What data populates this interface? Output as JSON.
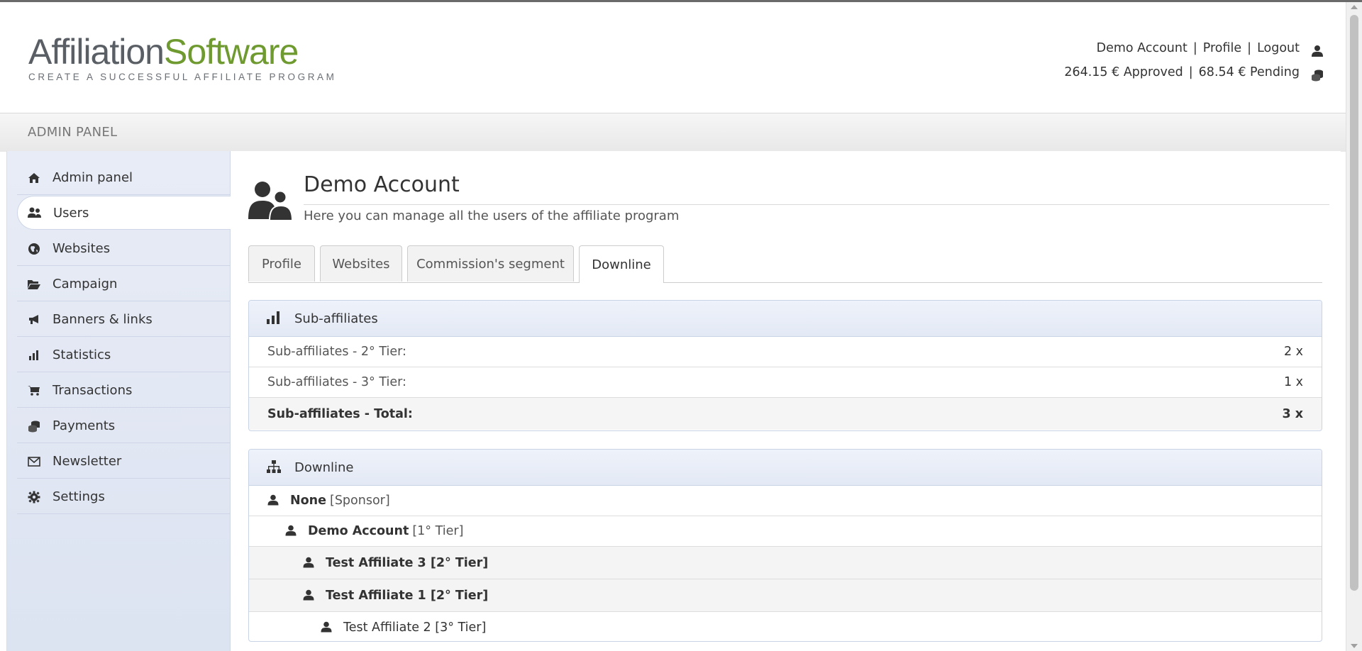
{
  "brand": {
    "logo_word_1": "Affiliation",
    "logo_word_2": "Software",
    "tagline": "CREATE A SUCCESSFUL AFFILIATE PROGRAM",
    "color_dark": "#5a5f66",
    "color_green": "#6e9a30"
  },
  "header": {
    "account_link": "Demo Account",
    "profile_link": "Profile",
    "logout_link": "Logout",
    "separator": "|",
    "approved": "264.15 € Approved",
    "pending": "68.54 € Pending",
    "user_icon": "user-icon",
    "coins_icon": "coins-icon"
  },
  "admin_bar": {
    "label": "ADMIN PANEL"
  },
  "sidebar": {
    "items": [
      {
        "label": "Admin panel",
        "icon": "home-icon"
      },
      {
        "label": "Users",
        "icon": "users-icon",
        "active": true
      },
      {
        "label": "Websites",
        "icon": "globe-icon"
      },
      {
        "label": "Campaign",
        "icon": "folder-open-icon"
      },
      {
        "label": "Banners & links",
        "icon": "bullhorn-icon"
      },
      {
        "label": "Statistics",
        "icon": "bar-chart-icon"
      },
      {
        "label": "Transactions",
        "icon": "cart-icon"
      },
      {
        "label": "Payments",
        "icon": "coins-icon"
      },
      {
        "label": "Newsletter",
        "icon": "envelope-icon"
      },
      {
        "label": "Settings",
        "icon": "gear-icon"
      }
    ]
  },
  "page": {
    "title": "Demo Account",
    "subtitle": "Here you can manage all the users of the affiliate program",
    "icon": "users-large-icon"
  },
  "tabs": [
    {
      "label": "Profile"
    },
    {
      "label": "Websites"
    },
    {
      "label": "Commission's segment"
    },
    {
      "label": "Downline",
      "active": true
    }
  ],
  "subaffiliates": {
    "title": "Sub-affiliates",
    "icon": "bar-chart-icon",
    "rows": [
      {
        "label": "Sub-affiliates - 2° Tier:",
        "value": "2 x"
      },
      {
        "label": "Sub-affiliates - 3° Tier:",
        "value": "1 x"
      }
    ],
    "total": {
      "label": "Sub-affiliates - Total:",
      "value": "3 x"
    }
  },
  "downline": {
    "title": "Downline",
    "icon": "sitemap-icon",
    "rows": [
      {
        "name": "None",
        "tier": "[Sponsor]",
        "level": 0
      },
      {
        "name": "Demo Account",
        "tier": "[1° Tier]",
        "level": 1
      },
      {
        "name": "Test Affiliate 3 [2° Tier]",
        "tier": "",
        "level": 2
      },
      {
        "name": "Test Affiliate 1 [2° Tier]",
        "tier": "",
        "level": 2
      },
      {
        "name": "Test Affiliate 2 [3° Tier]",
        "tier": "",
        "level": 3
      }
    ]
  }
}
